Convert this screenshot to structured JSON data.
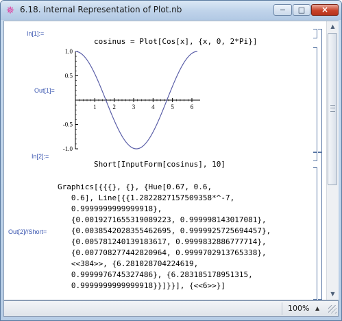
{
  "window": {
    "title": "6.18. Internal Representation of Plot.nb",
    "minimize_glyph": "−",
    "maximize_glyph": "□",
    "close_glyph": "×"
  },
  "cells": {
    "in1": {
      "label": "In[1]:=",
      "code": "cosinus = Plot[Cos[x], {x, 0, 2*Pi}]"
    },
    "out1": {
      "label": "Out[1]="
    },
    "in2": {
      "label": "In[2]:=",
      "code": "Short[InputForm[cosinus], 10]"
    },
    "out2": {
      "label": "Out[2]//Short=",
      "lines": [
        "Graphics[{{{}, {}, {Hue[0.67, 0.6,",
        "   0.6], Line[{{1.2822827157509358*^-7,",
        "   0.9999999999999918},",
        "   {0.0019271655319089223, 0.999998143017081},",
        "   {0.0038542028355462695, 0.9999925725694457},",
        "   {0.005781240139183617, 0.9999832886777714},",
        "   {0.007708277442820964, 0.9999702913765338},",
        "   <<384>>, {6.281028704224619,",
        "   0.9999976745327486}, {6.283185178951315,",
        "   0.9999999999999918}}]}}], {<<6>>}]"
      ]
    }
  },
  "chart_data": {
    "type": "line",
    "function": "Cos[x]",
    "x_ticks": [
      "1",
      "2",
      "3",
      "4",
      "5",
      "6"
    ],
    "y_ticks": [
      "1.0",
      "0.5",
      "-0.5",
      "-1.0"
    ],
    "xlim": [
      0,
      6.2832
    ],
    "ylim": [
      -1.0,
      1.0
    ],
    "line_color": "#5b5fa8",
    "series": [
      {
        "x": [
          0,
          0.5236,
          1.0472,
          1.5708,
          2.0944,
          2.618,
          3.1416,
          3.6652,
          4.1888,
          4.7124,
          5.236,
          5.7596,
          6.2832
        ],
        "values": [
          1.0,
          0.866,
          0.5,
          0.0,
          -0.5,
          -0.866,
          -1.0,
          -0.866,
          -0.5,
          0.0,
          0.5,
          0.866,
          1.0
        ]
      }
    ]
  },
  "statusbar": {
    "zoom": "100%",
    "zoom_arrow": "▲"
  }
}
